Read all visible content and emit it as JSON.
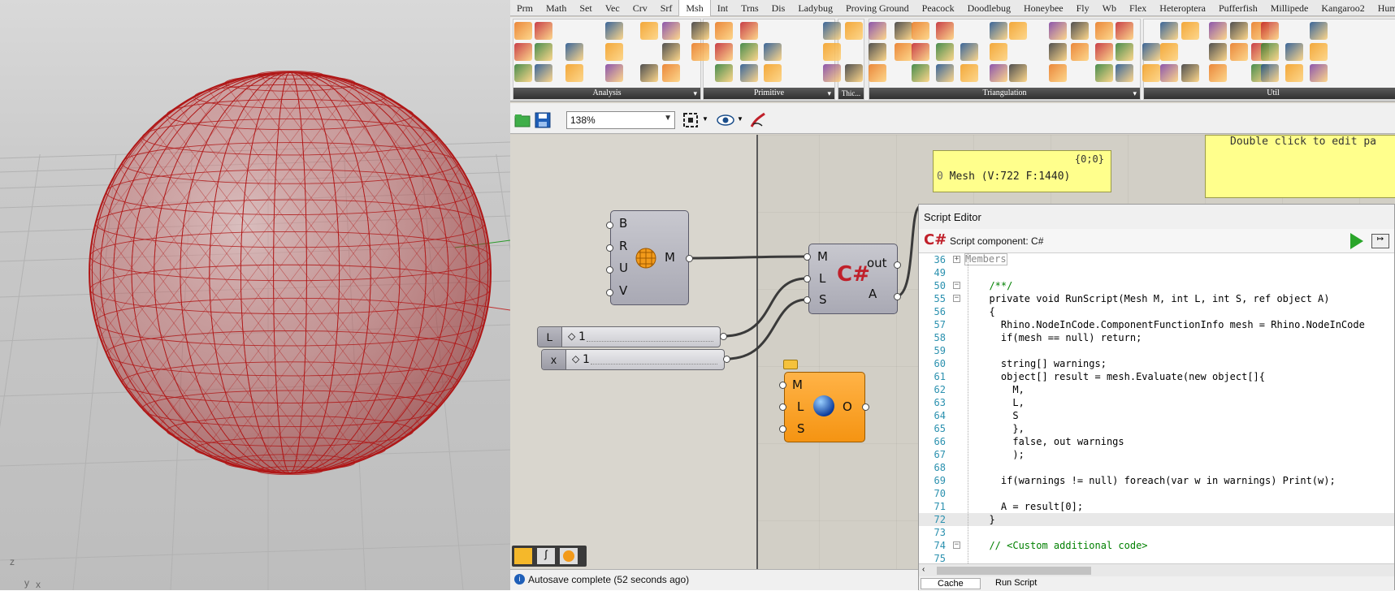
{
  "viewport": {
    "axis_labels": [
      "z",
      "y",
      "x"
    ],
    "sphere_color": "#b01818"
  },
  "grasshopper": {
    "tabs": [
      "Prm",
      "Math",
      "Set",
      "Vec",
      "Crv",
      "Srf",
      "Msh",
      "Int",
      "Trns",
      "Dis",
      "Ladybug",
      "Proving Ground",
      "Peacock",
      "Doodlebug",
      "Honeybee",
      "Fly",
      "Wb",
      "Flex",
      "Heteroptera",
      "Pufferfish",
      "Millipede",
      "Kangaroo2",
      "Human"
    ],
    "active_tab": "Msh",
    "ribbon_panels": [
      "Analysis",
      "Primitive",
      "Triangulation",
      "Util"
    ],
    "ribbon_misc_label": "Thic...",
    "zoom": "138%",
    "canvas": {
      "mesh_panel": {
        "path": "{0;0}",
        "index": "0",
        "value": "Mesh (V:722  F:1440)"
      },
      "note_panel": "Double click to edit pa",
      "sphere_component": {
        "inputs": [
          "B",
          "R",
          "U",
          "V"
        ],
        "output": "M"
      },
      "script_component": {
        "inputs": [
          "M",
          "L",
          "S"
        ],
        "outputs": [
          "out",
          "A"
        ]
      },
      "slider_L": {
        "label": "L",
        "value": "1"
      },
      "slider_x": {
        "label": "x",
        "value": "1"
      },
      "cluster_component": {
        "inputs": [
          "M",
          "L",
          "S"
        ],
        "output": "O"
      }
    },
    "status": "Autosave complete (52 seconds ago)"
  },
  "script_editor": {
    "title": "Script Editor",
    "component_label": "Script component: C#",
    "lines": [
      {
        "n": "36",
        "t": "Members",
        "fold": "+"
      },
      {
        "n": "49",
        "t": ""
      },
      {
        "n": "50",
        "t": "  /**/",
        "fold": "-"
      },
      {
        "n": "55",
        "t": "  private void RunScript(Mesh M, int L, int S, ref object A)",
        "fold": "-"
      },
      {
        "n": "56",
        "t": "  {"
      },
      {
        "n": "57",
        "t": "    Rhino.NodeInCode.ComponentFunctionInfo mesh = Rhino.NodeInCode"
      },
      {
        "n": "58",
        "t": "    if(mesh == null) return;"
      },
      {
        "n": "59",
        "t": ""
      },
      {
        "n": "60",
        "t": "    string[] warnings;"
      },
      {
        "n": "61",
        "t": "    object[] result = mesh.Evaluate(new object[]{"
      },
      {
        "n": "62",
        "t": "      M,"
      },
      {
        "n": "63",
        "t": "      L,"
      },
      {
        "n": "64",
        "t": "      S"
      },
      {
        "n": "65",
        "t": "      },"
      },
      {
        "n": "66",
        "t": "      false, out warnings"
      },
      {
        "n": "67",
        "t": "      );"
      },
      {
        "n": "68",
        "t": ""
      },
      {
        "n": "69",
        "t": "    if(warnings != null) foreach(var w in warnings) Print(w);"
      },
      {
        "n": "70",
        "t": ""
      },
      {
        "n": "71",
        "t": "    A = result[0];"
      },
      {
        "n": "72",
        "t": "  }"
      },
      {
        "n": "73",
        "t": ""
      },
      {
        "n": "74",
        "t": "  // <Custom additional code>",
        "fold": "-"
      },
      {
        "n": "75",
        "t": ""
      }
    ],
    "bottom_tabs": [
      "Cache",
      "Run Script"
    ]
  }
}
